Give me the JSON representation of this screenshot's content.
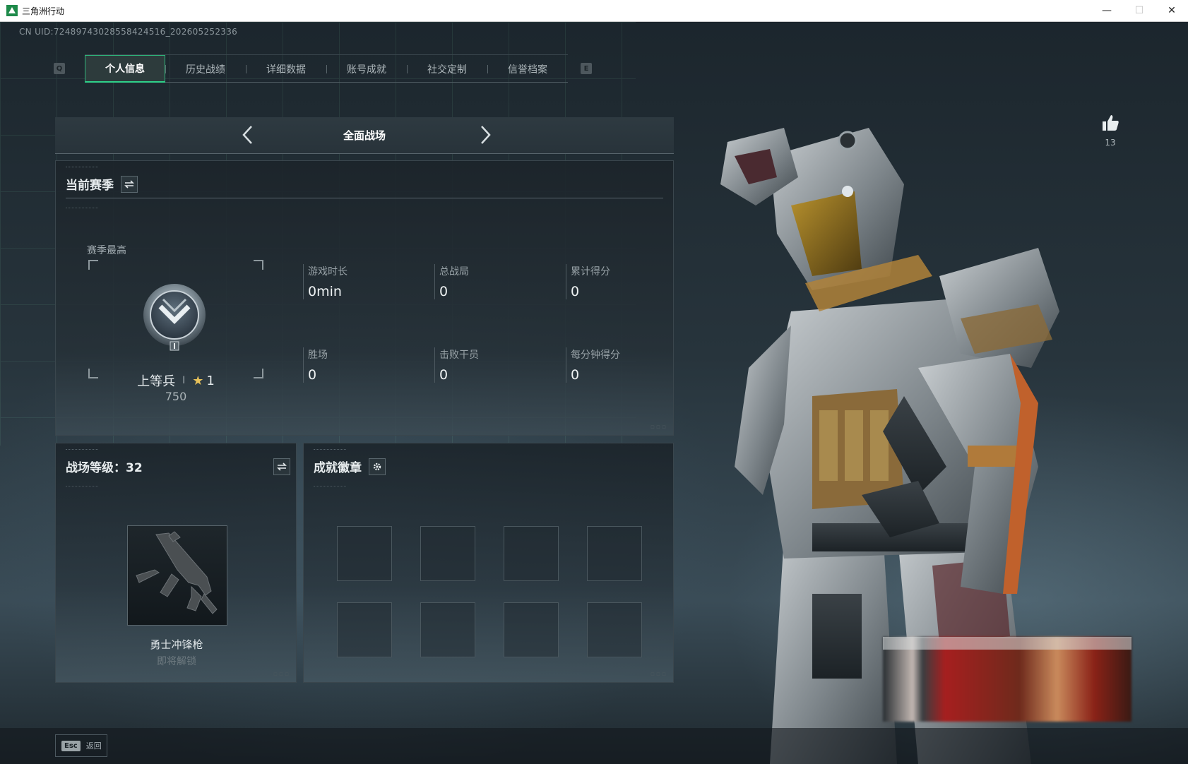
{
  "window": {
    "title": "三角洲行动",
    "controls": {
      "minimize": "—",
      "maximize": "☐",
      "close": "✕"
    }
  },
  "uid": "CN UID:7248974302855842451​6_202605252336",
  "tabs": {
    "left_key": "Q",
    "right_key": "E",
    "items": [
      {
        "label": "个人信息",
        "active": true
      },
      {
        "label": "历史战绩",
        "active": false
      },
      {
        "label": "详细数据",
        "active": false
      },
      {
        "label": "账号成就",
        "active": false
      },
      {
        "label": "社交定制",
        "active": false
      },
      {
        "label": "信誉档案",
        "active": false
      }
    ]
  },
  "mode": {
    "label": "全面战场",
    "prev_icon": "chevron-left-icon",
    "next_icon": "chevron-right-icon"
  },
  "season": {
    "title": "当前赛季",
    "switch_icon": "swap-icon",
    "best_label": "赛季最高",
    "rank_name": "上等兵",
    "rank_numeral": "I",
    "rank_stars": "1",
    "rank_points": "750",
    "stats": [
      {
        "label": "游戏时长",
        "value": "0min"
      },
      {
        "label": "总战局",
        "value": "0"
      },
      {
        "label": "累计得分",
        "value": "0"
      },
      {
        "label": "胜场",
        "value": "0"
      },
      {
        "label": "击败干员",
        "value": "0"
      },
      {
        "label": "每分钟得分",
        "value": "0"
      }
    ]
  },
  "level": {
    "title": "战场等级：32",
    "switch_icon": "swap-icon",
    "weapon_name": "勇士冲锋枪",
    "weapon_status": "即将解锁"
  },
  "badges": {
    "title": "成就徽章",
    "settings_icon": "gear-icon",
    "slots": 8
  },
  "likes": {
    "icon": "thumbs-up-icon",
    "count": "13"
  },
  "footer": {
    "esc_key": "Esc",
    "back_label": "返回"
  },
  "colors": {
    "accent": "#2fd18a",
    "background": "#1a2329",
    "panel": "#1a2228"
  }
}
